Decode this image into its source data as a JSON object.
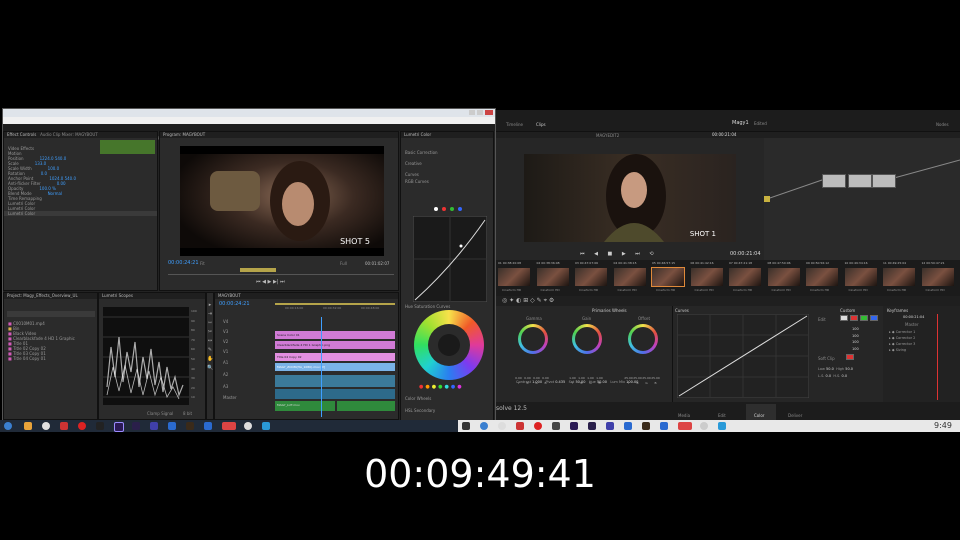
{
  "premiere": {
    "menu": [
      "File",
      "Edit",
      "Clip",
      "Sequence",
      "Marker",
      "Title",
      "Window",
      "Help"
    ],
    "workspaces": [
      "Assembly",
      "Editing",
      "Color",
      "Effects",
      "Audio",
      "Titles",
      "Libraries",
      "ELEMENT",
      "GSU Elements 1.07",
      "Editing (CS5.5)",
      "Ken Burns"
    ],
    "active_workspace": "Color",
    "effect_controls_tab": "Effect Controls",
    "audio_mixer_tab": "Audio Clip Mixer: MAGYBOUT",
    "program_tab": "Program: MAGYBOUT",
    "lumetri_tab": "Lumetri Color",
    "effect_rows": [
      "Video Effects",
      "Motion",
      "Position",
      "Scale",
      "Scale Width",
      "Rotation",
      "Anchor Point",
      "Anti-flicker Filter",
      "Opacity",
      "Blend Mode",
      "Time Remapping",
      "Lumetri Color",
      "Lumetri Color",
      "Lumetri Color"
    ],
    "effect_values": [
      "",
      "",
      "1224.0  540.0",
      "133.0",
      "100.0",
      "0.0",
      "1024.0  540.0",
      "0.00",
      "100.0 %",
      "Normal",
      "",
      "",
      "",
      ""
    ],
    "program_timecode": "00:00:24:21",
    "program_duration": "00:01:02:07",
    "fit_label": "Fit",
    "full_label": "Full",
    "shot_label": "SHOT 5",
    "lumetri_sections": [
      "Basic Correction",
      "Creative",
      "Curves",
      "RGB Curves",
      "Hue Saturation Curves",
      "Color Wheels",
      "HSL Secondary"
    ],
    "project_tab": "Project: Magy_Effects_Overview_UL",
    "scopes_tab": "Lumetri Scopes",
    "project_items": [
      "C0010M01.mp4",
      "Bin",
      "Black Video",
      "Clearblackfade 4 HD 1 Graphic",
      "Title 01",
      "Title 02 Copy 02",
      "Title 03 Copy 01",
      "Title 04 Copy 01"
    ],
    "scope_labels": [
      "100",
      "90",
      "80",
      "70",
      "60",
      "50",
      "40",
      "30",
      "20",
      "10",
      "0"
    ],
    "scope_clamp": "Clamp Signal",
    "scope_mode": "8 bit",
    "timeline_tab": "MAGYBOUT",
    "timeline_timecode": "00:00:24:21",
    "timeline_ticks": [
      "00:00:16:00",
      "00:00:32:00",
      "00:00:48:00"
    ],
    "track_names": [
      "V4",
      "V3",
      "V2",
      "V1",
      "A1",
      "A2",
      "A3",
      "Master"
    ],
    "clips": [
      "Scene Color 01",
      "Title 04 Copy 02",
      "Clearblackfade 4 HD 1 Graphic.png",
      "MAGY_ZOOM",
      "MAGY_ZOOM(HA_1080).mov [V]",
      "MAGY_LUT.mov"
    ]
  },
  "resolve": {
    "menu": [
      "File",
      "Edit",
      "Trim",
      "Timeline",
      "Clip",
      "Mark",
      "View",
      "Playback",
      "Color",
      "Nodes",
      "Workspace",
      "Help"
    ],
    "project_name": "Magy1",
    "project_state": "Edited",
    "timeline_label": "Timeline",
    "clips_label": "Clips",
    "nodes_label": "Nodes",
    "timeline_name": "MAGYEDIT2",
    "timecode": "00:00:21:04",
    "viewer_timecode": "00:00:21:04",
    "shot_label": "SHOT 1",
    "thumb_timecodes": [
      "00:38:20:08",
      "00:38:36:08",
      "00:47:07:06",
      "00:41:38:15",
      "00:46:57:15",
      "00:41:42:16",
      "00:47:21:18",
      "00:47:50:06",
      "00:50:56:12",
      "00:49:34:16",
      "00:49:25:04",
      "00:50:47:21"
    ],
    "thumb_nums": [
      "01",
      "02",
      "03",
      "04",
      "05",
      "06",
      "07",
      "08",
      "09",
      "10",
      "11",
      "12"
    ],
    "thumb_label": "Cineform HD",
    "primaries_title": "Primaries Wheels",
    "wheels": [
      "Gamma",
      "Gain",
      "Offset"
    ],
    "wheel_values": [
      [
        "0.00",
        "0.00",
        "0.00",
        "0.00"
      ],
      [
        "1.00",
        "1.00",
        "1.00",
        "1.00"
      ],
      [
        "25.00",
        "25.00",
        "25.00",
        "25.00"
      ]
    ],
    "wheel_channels": [
      "Y",
      "R",
      "G",
      "B"
    ],
    "contrast_label": "Contrast",
    "contrast_value": "1.000",
    "pivot_label": "Pivot",
    "pivot_value": "0.435",
    "sat_label": "Sat",
    "sat_value": "50.00",
    "hue_label": "Hue",
    "hue_value": "50.00",
    "lummix_label": "Lum Mix",
    "lummix_value": "100.00",
    "curves_title": "Curves",
    "custom_title": "Custom",
    "edit_label": "Edit",
    "curve_values": [
      "100",
      "100",
      "100",
      "100"
    ],
    "softclip_label": "Soft Clip",
    "softclip_rows": [
      [
        "Low",
        "50.0",
        "High",
        "50.0"
      ],
      [
        "L.S.",
        "0.0",
        "H.S.",
        "0.0"
      ]
    ],
    "keyframes_title": "Keyframes",
    "keyframes_timecode": "00:00:21:04",
    "keyframes_master": "Master",
    "keyframes_items": [
      "Corrector 1",
      "Corrector 2",
      "Corrector 3",
      "Sizing"
    ],
    "pages": [
      "Media",
      "Edit",
      "Color",
      "Deliver"
    ],
    "active_page": "Color",
    "version_label": "solve 12.5"
  },
  "taskbar_right": "9:49",
  "big_timecode": "00:09:49:41"
}
